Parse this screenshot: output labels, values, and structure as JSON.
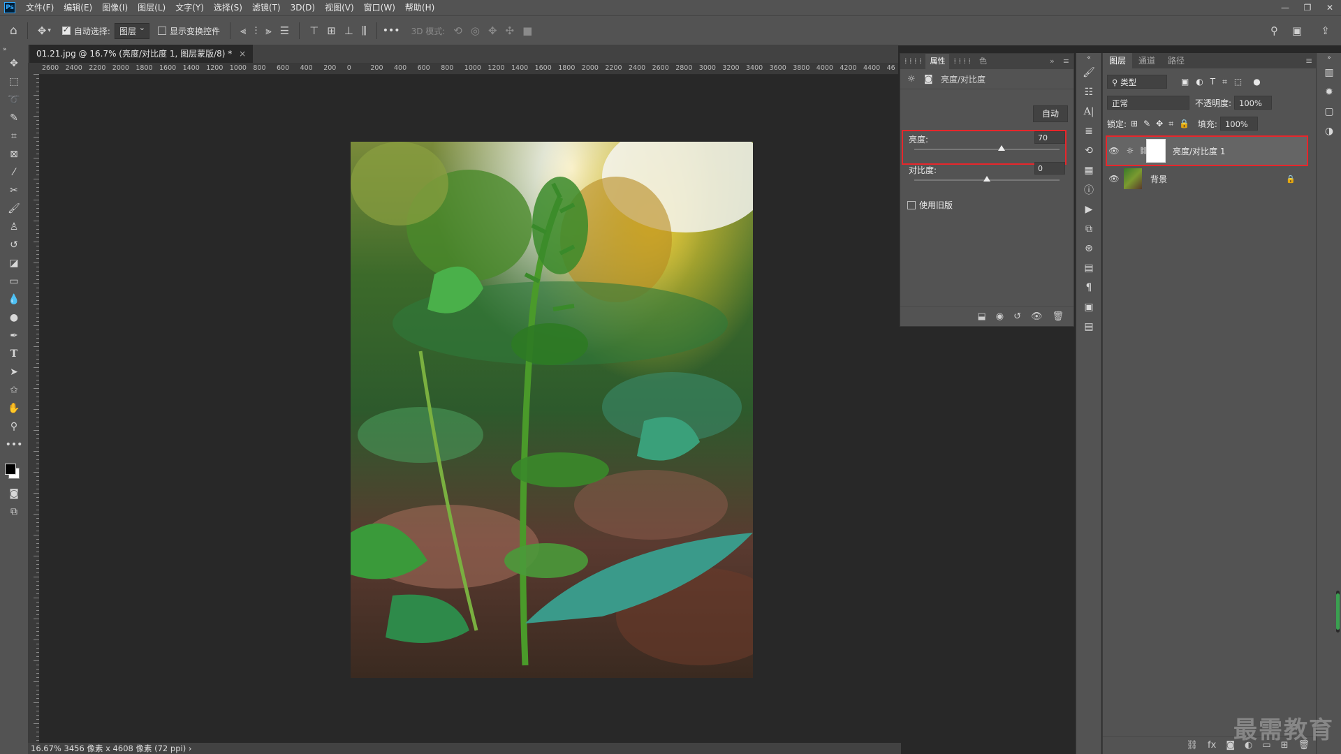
{
  "menubar": {
    "app_icon": "Ps",
    "items": [
      "文件(F)",
      "编辑(E)",
      "图像(I)",
      "图层(L)",
      "文字(Y)",
      "选择(S)",
      "滤镜(T)",
      "3D(D)",
      "视图(V)",
      "窗口(W)",
      "帮助(H)"
    ],
    "win_controls": [
      "—",
      "❐",
      "✕"
    ]
  },
  "options": {
    "auto_select_label": "自动选择:",
    "auto_select_value": "图层",
    "show_transform_label": "显示变换控件",
    "more_label": "•••",
    "mode_3d_label": "3D 模式:"
  },
  "document": {
    "tab_title": "01.21.jpg @ 16.7% (亮度/对比度 1, 图层蒙版/8) *",
    "tab_close": "×",
    "status_zoom": "16.67%",
    "status_info": "3456 像素 x 4608 像素 (72 ppi)",
    "ruler_ticks": [
      "2600",
      "2400",
      "2200",
      "2000",
      "1800",
      "1600",
      "1400",
      "1200",
      "1000",
      "800",
      "600",
      "400",
      "200",
      "0",
      "200",
      "400",
      "600",
      "800",
      "1000",
      "1200",
      "1400",
      "1600",
      "1800",
      "2000",
      "2200",
      "2400",
      "2600",
      "2800",
      "3000",
      "3200",
      "3400",
      "3600",
      "3800",
      "4000",
      "4200",
      "4400",
      "46"
    ]
  },
  "properties": {
    "tab_active": "属性",
    "tab_other": "色",
    "title": "亮度/对比度",
    "auto_button": "自动",
    "brightness_label": "亮度:",
    "brightness_value": "70",
    "brightness_level": 0.6,
    "contrast_label": "对比度:",
    "contrast_value": "0",
    "contrast_level": 0.5,
    "legacy_label": "使用旧版"
  },
  "layers": {
    "tabs": [
      "图层",
      "通道",
      "路径"
    ],
    "filter_label": "类型",
    "blend_mode": "正常",
    "opacity_label": "不透明度:",
    "opacity_value": "100%",
    "lock_label": "锁定:",
    "fill_label": "填充:",
    "fill_value": "100%",
    "items": [
      {
        "name": "亮度/对比度 1"
      },
      {
        "name": "背景"
      }
    ]
  },
  "watermark": "最需教育",
  "colors": {
    "highlight_red": "#e8262b",
    "panel_bg": "#535353",
    "canvas_bg": "#282828"
  }
}
